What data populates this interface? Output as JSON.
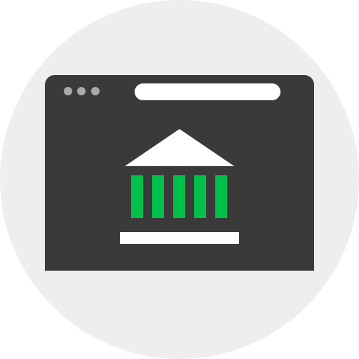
{
  "icon": {
    "name": "bank-website-icon",
    "elements": [
      "browser-window-icon",
      "bank-building-icon"
    ]
  },
  "colors": {
    "badge": "#eeeeee",
    "window": "#3a3a3a",
    "window_dots": "#a9a9a9",
    "address_bar": "#ffffff",
    "roof_and_base": "#ffffff",
    "columns": "#00c04b"
  },
  "window": {
    "control_dots": 3,
    "columns": 5
  }
}
